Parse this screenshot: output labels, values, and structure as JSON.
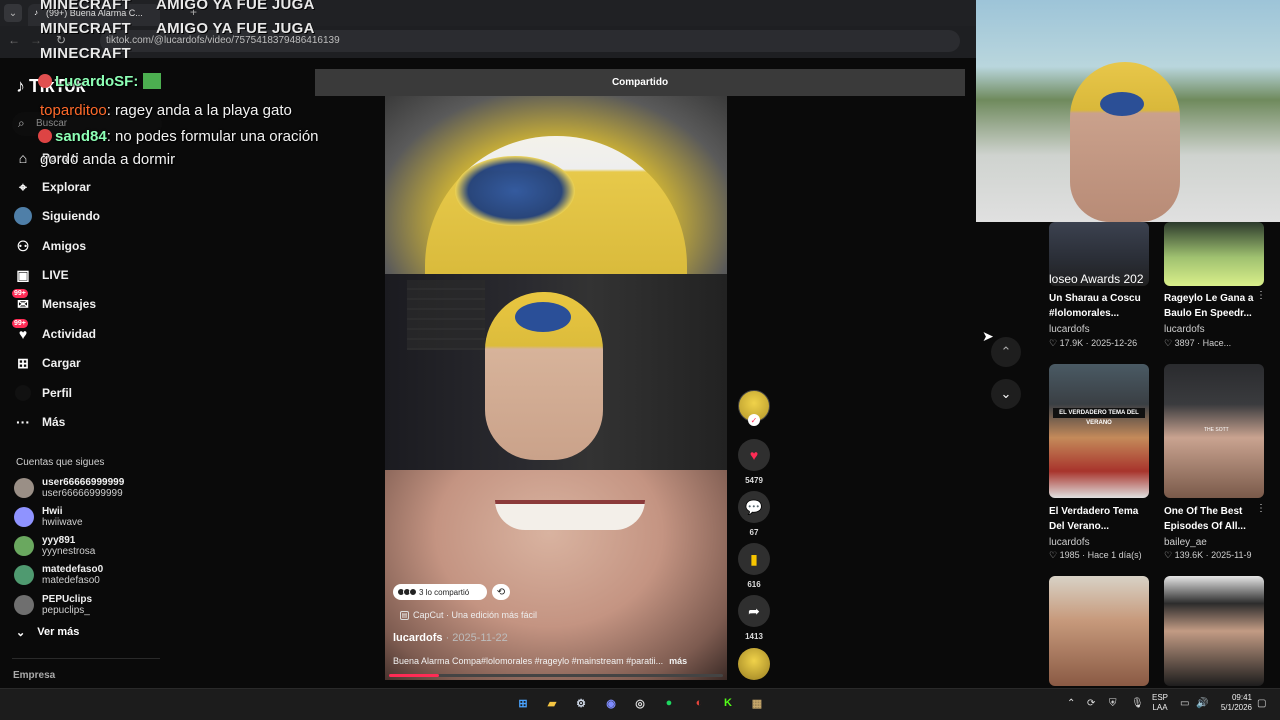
{
  "browser": {
    "tab_title": "(99+) Buena Alarma C...",
    "url": "tiktok.com/@lucardofs/video/7575418379486416139"
  },
  "overlay": {
    "minecraft_labels": [
      "MINECRAFT",
      "MINECRAFT",
      "MINECRAFT"
    ],
    "top_message": "AMIGO YA FUE JUGA",
    "top_message_2": "AMIGO YA FUE JUGA",
    "chat": [
      {
        "user": "LucardoSF:",
        "text": "",
        "color": "#8dffb5"
      },
      {
        "user": "toparditoo",
        "text": ": ragey anda a la playa gato",
        "color": "#ff6a2b"
      },
      {
        "user": "sand84",
        "text": ": no podes formular una oración",
        "color": "#8dffb5"
      },
      {
        "user": "",
        "text": "gordo anda a dormir",
        "color": "#ffffff"
      }
    ]
  },
  "sidebar": {
    "logo_text": "TikTok",
    "search_placeholder": "Buscar",
    "nav": [
      {
        "label": "Para ti",
        "icon": "home-icon"
      },
      {
        "label": "Explorar",
        "icon": "compass-icon"
      },
      {
        "label": "Siguiendo",
        "icon": "following-icon"
      },
      {
        "label": "Amigos",
        "icon": "friends-icon"
      },
      {
        "label": "LIVE",
        "icon": "live-icon"
      },
      {
        "label": "Mensajes",
        "icon": "messages-icon",
        "badge": "99+"
      },
      {
        "label": "Actividad",
        "icon": "activity-icon",
        "badge": "99+"
      },
      {
        "label": "Cargar",
        "icon": "upload-icon"
      },
      {
        "label": "Perfil",
        "icon": "profile-icon"
      },
      {
        "label": "Más",
        "icon": "more-icon"
      }
    ],
    "following_title": "Cuentas que sigues",
    "following": [
      {
        "name": "user66666999999",
        "handle": "user66666999999",
        "color": "#9a8f86"
      },
      {
        "name": "Hwii",
        "handle": "hwiiwave",
        "color": "#8f93ff"
      },
      {
        "name": "yyy891",
        "handle": "yyynestrosa",
        "color": "#6aa85f"
      },
      {
        "name": "matedefaso0",
        "handle": "matedefaso0",
        "color": "#4f9a70"
      },
      {
        "name": "PEPUclips",
        "handle": "pepuclips_",
        "color": "#6f6f6f"
      }
    ],
    "see_more": "Ver más",
    "company": "Empresa"
  },
  "shared_header": "Compartido",
  "video": {
    "shared_pill": "3 lo compartió",
    "capcut": "CapCut · Una edición más fácil",
    "author": "lucardofs",
    "date": " · 2025-11-22",
    "caption": "Buena Alarma Compa#lolomorales #rageylo #mainstream #paratii...",
    "caption_more": "más",
    "progress_fraction": 0.15
  },
  "actions": {
    "likes": "5479",
    "comments": "67",
    "saves": "616",
    "shares": "1413"
  },
  "recommendations": [
    {
      "title_1": "Un Sharau a Coscu",
      "title_2": "#lolomorales...",
      "author": "lucardofs",
      "likes": "17.9K",
      "date": "2025-12-26",
      "thumb_text": "loseo Awards 202"
    },
    {
      "title_1": "Rageylo Le Gana a",
      "title_2": "Baulo En Speedr...",
      "author": "lucardofs",
      "likes": "3897",
      "date": "Hace..."
    },
    {
      "title_1": "El Verdadero Tema",
      "title_2": "Del Verano...",
      "author": "lucardofs",
      "likes": "1985",
      "date": "Hace 1 día(s)",
      "thumb_text": "EL VERDADERO TEMA DEL VERANO"
    },
    {
      "title_1": "One Of The Best",
      "title_2": "Episodes Of All...",
      "author": "bailey_ae",
      "likes": "139.6K",
      "date": "2025-11-9",
      "thumb_text": "THE SOTT"
    }
  ],
  "taskbar": {
    "lang_1": "ESP",
    "lang_2": "LAA",
    "time": "09:41",
    "date": "5/1/2026"
  },
  "colors": {
    "accent": "#fe2c55",
    "save": "#f7c500"
  }
}
